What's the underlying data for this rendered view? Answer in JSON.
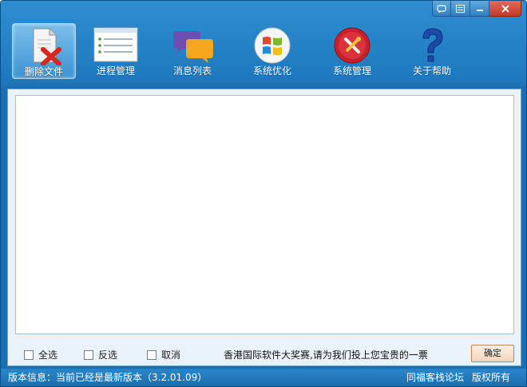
{
  "window": {
    "controls": [
      {
        "name": "skin-icon",
        "glyph": "⬚"
      },
      {
        "name": "menu-icon",
        "glyph": "▤"
      },
      {
        "name": "minimize-icon",
        "glyph": "−"
      },
      {
        "name": "close-icon",
        "glyph": "✕"
      }
    ]
  },
  "toolbar": {
    "items": [
      {
        "label": "删除文件",
        "icon": "delete-file-icon"
      },
      {
        "label": "进程管理",
        "icon": "process-list-icon"
      },
      {
        "label": "消息列表",
        "icon": "message-bubbles-icon"
      },
      {
        "label": "系统优化",
        "icon": "windows-logo-icon"
      },
      {
        "label": "系统管理",
        "icon": "tools-icon"
      },
      {
        "label": "关于帮助",
        "icon": "question-mark-icon"
      }
    ]
  },
  "panel": {
    "checkboxes": [
      {
        "label": "全选",
        "checked": false
      },
      {
        "label": "反选",
        "checked": false
      },
      {
        "label": "取消",
        "checked": false
      }
    ],
    "notice": "香港国际软件大奖赛,请为我们投上您宝贵的一票",
    "ok_label": "确定"
  },
  "status": {
    "version": "版本信息：当前已经是最新版本（3.2.01.09）",
    "forum": "同福客栈论坛",
    "copyright": "版权所有"
  },
  "colors": {
    "accent": "#1f78bd",
    "close": "#c23a26"
  }
}
